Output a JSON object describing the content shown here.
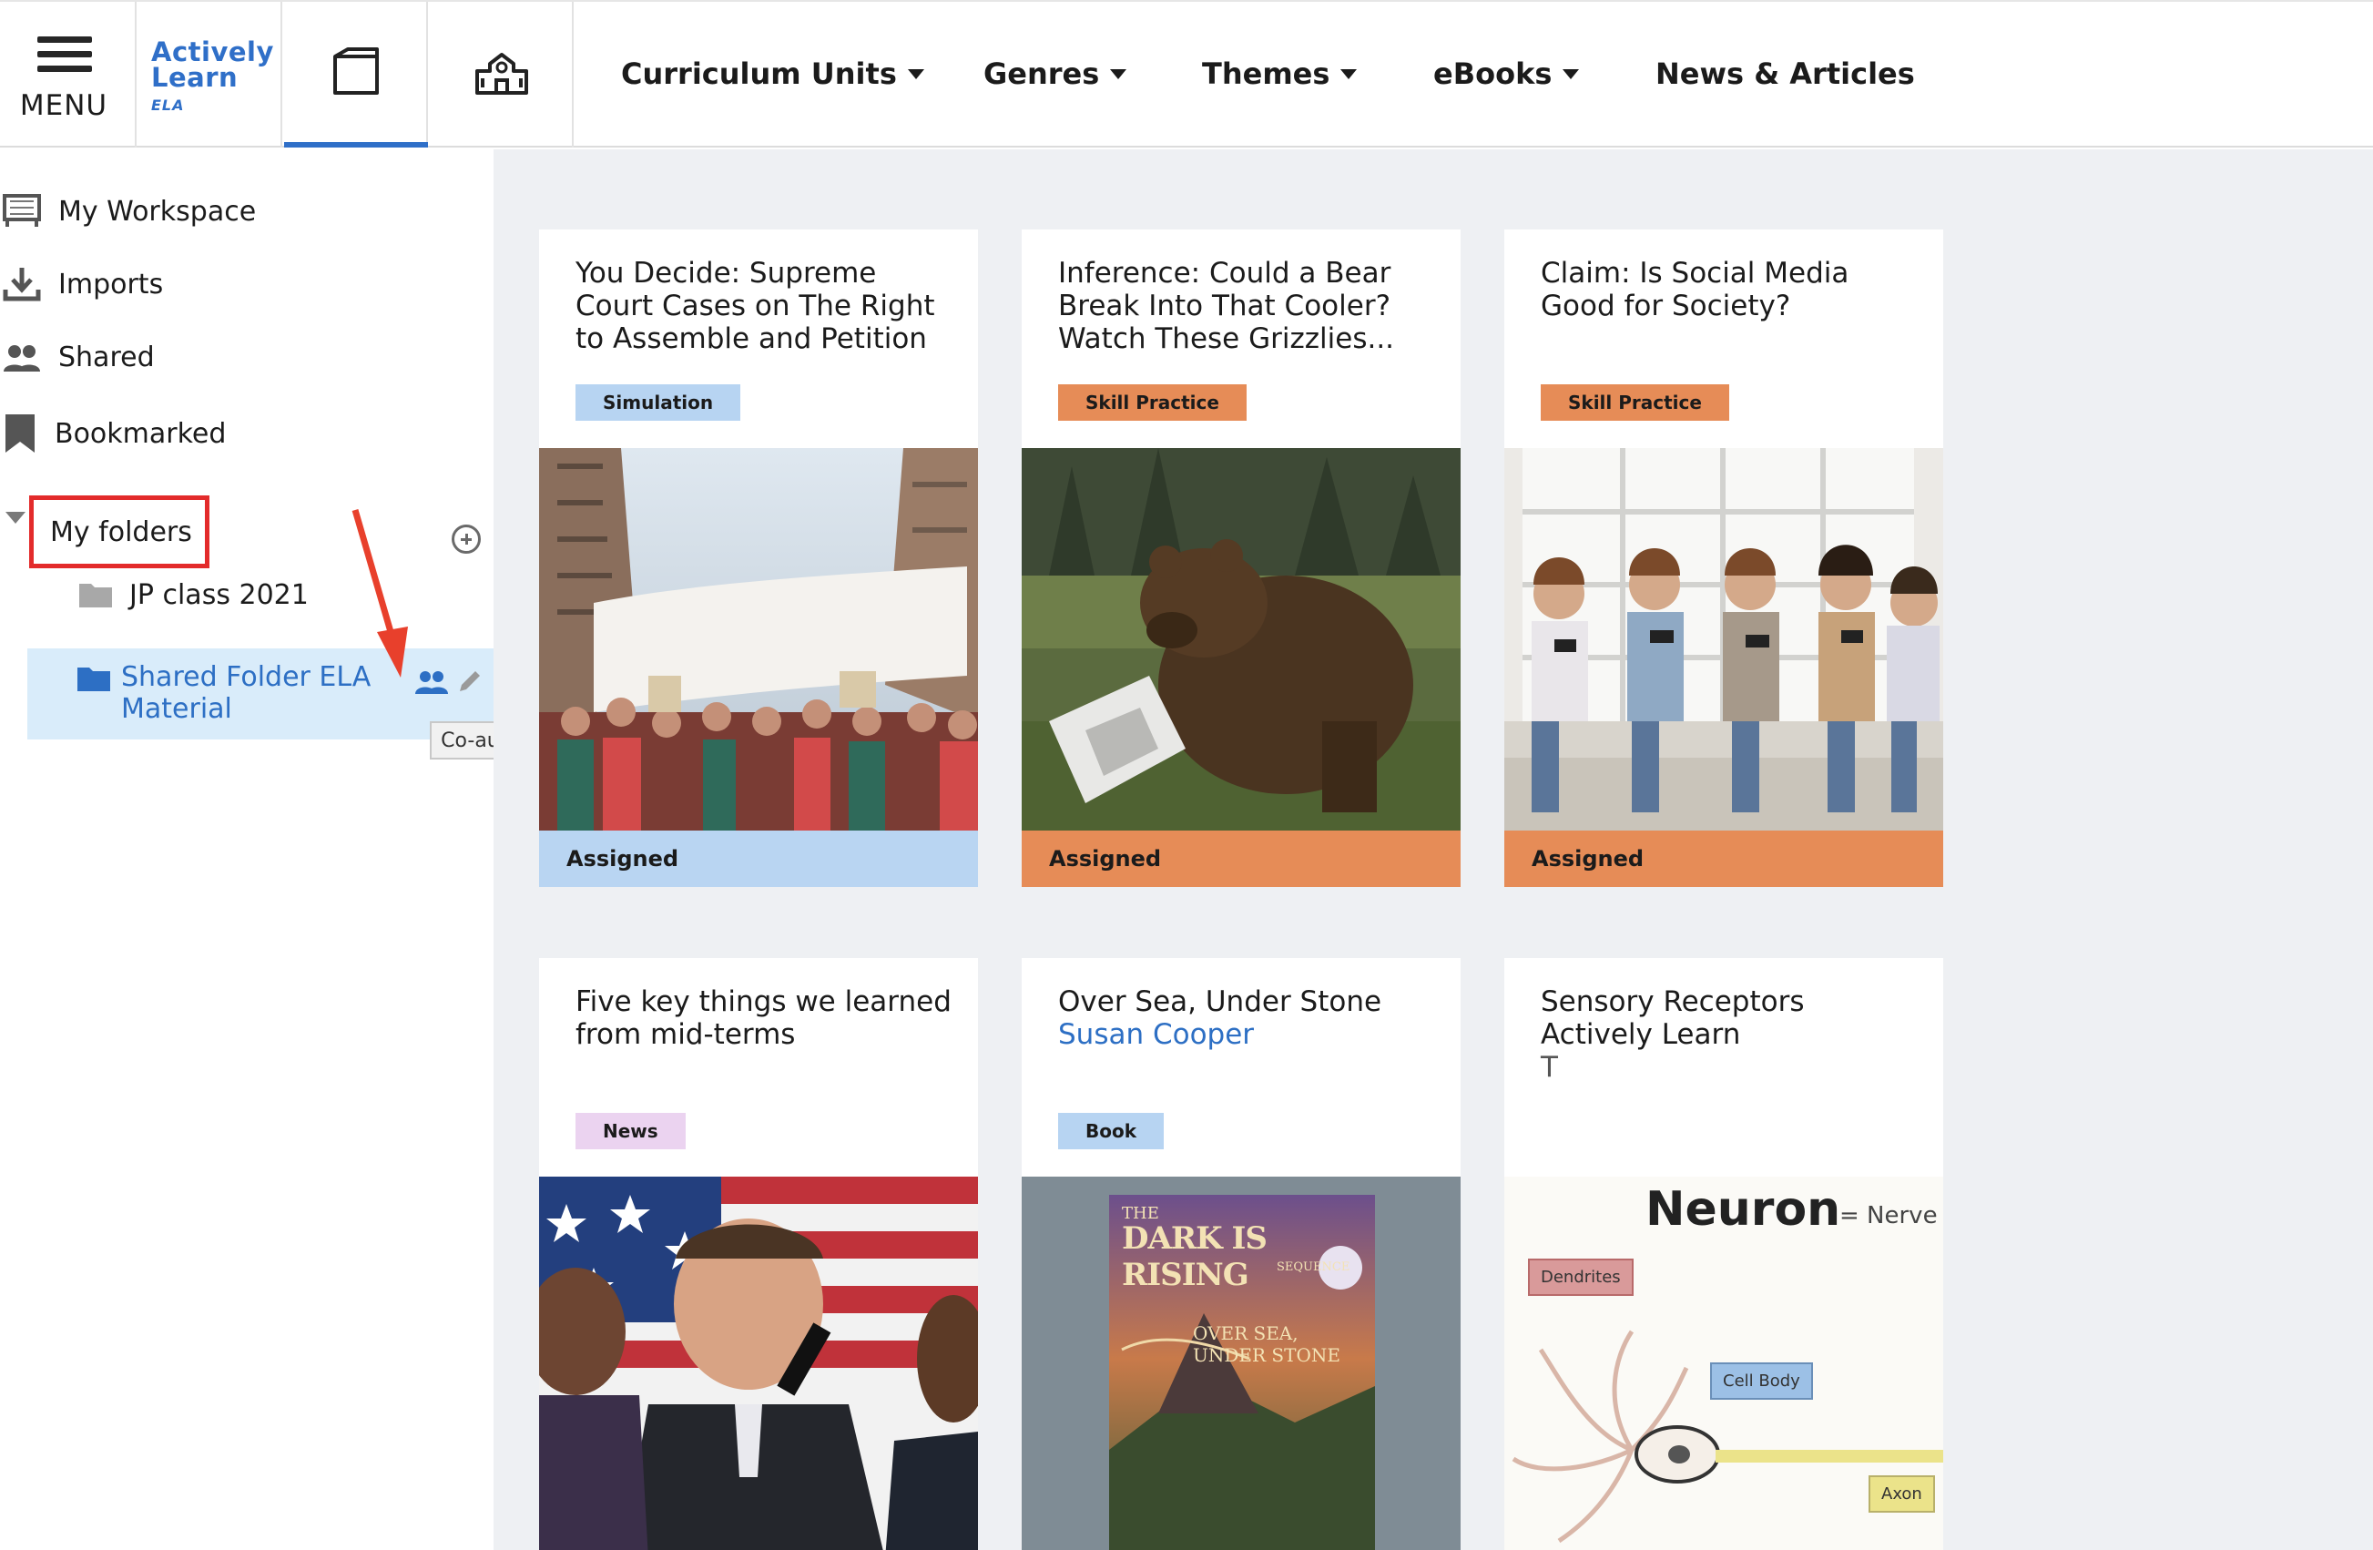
{
  "header": {
    "menu_label": "MENU",
    "logo": {
      "line1": "Actively",
      "line2": "Learn",
      "line3": "ELA"
    },
    "nav": [
      {
        "label": "Curriculum Units",
        "has_dropdown": true
      },
      {
        "label": "Genres",
        "has_dropdown": true
      },
      {
        "label": "Themes",
        "has_dropdown": true
      },
      {
        "label": "eBooks",
        "has_dropdown": true
      },
      {
        "label": "News & Articles",
        "has_dropdown": false
      }
    ],
    "active_tab": "library",
    "accent_color": "#2f6fc8"
  },
  "sidebar": {
    "items": [
      {
        "label": "My Workspace",
        "icon": "workspace-icon"
      },
      {
        "label": "Imports",
        "icon": "import-icon"
      },
      {
        "label": "Shared",
        "icon": "people-icon"
      },
      {
        "label": "Bookmarked",
        "icon": "bookmark-icon"
      }
    ],
    "folders_header": "My folders",
    "folders": [
      {
        "label": "JP class 2021",
        "icon": "folder-icon",
        "selected": false
      },
      {
        "label": "Shared Folder ELA Material",
        "icon": "folder-icon",
        "selected": true
      }
    ],
    "tooltip": "Co-author",
    "highlight_color": "#e32b2b",
    "selected_color": "#2d6fc4"
  },
  "cards": [
    {
      "title": "You Decide: Supreme Court Cases on The Right to Assemble and Petition",
      "author": "",
      "badge": "Simulation",
      "badge_color": "#b7d4f2",
      "status": "Assigned",
      "status_color": "#b9d5f2",
      "image": "protest-photo"
    },
    {
      "title": "Inference: Could a Bear Break Into That Cooler? Watch These Grizzlies...",
      "author": "",
      "badge": "Skill Practice",
      "badge_color": "#e68c57",
      "status": "Assigned",
      "status_color": "#e68c57",
      "image": "bear-photo"
    },
    {
      "title": "Claim: Is Social Media Good for Society?",
      "author": "",
      "badge": "Skill Practice",
      "badge_color": "#e68c57",
      "status": "Assigned",
      "status_color": "#e68c57",
      "image": "kids-phones-photo"
    },
    {
      "title": "Five key things we learned from mid-terms",
      "author": "",
      "badge": "News",
      "badge_color": "#ebd3f0",
      "status": "",
      "status_color": "",
      "image": "politician-photo"
    },
    {
      "title": "Over Sea, Under Stone",
      "author": "Susan Cooper",
      "badge": "Book",
      "badge_color": "#b7d4f2",
      "status": "",
      "status_color": "",
      "image": "book-cover",
      "cover_text": {
        "line1": "THE",
        "line2": "DARK IS RISING",
        "line3": "SEQUENCE",
        "line4": "OVER SEA,",
        "line5": "UNDER STONE"
      }
    },
    {
      "title": "Sensory Receptors Actively Learn",
      "author": "T",
      "badge": "",
      "badge_color": "",
      "status": "",
      "status_color": "",
      "image": "neuron-diagram",
      "diagram_text": {
        "title": "Neuron",
        "subtitle": "= Nerve",
        "label1": "Dendrites",
        "label2": "Cell Body",
        "label3": "Axon"
      }
    }
  ]
}
